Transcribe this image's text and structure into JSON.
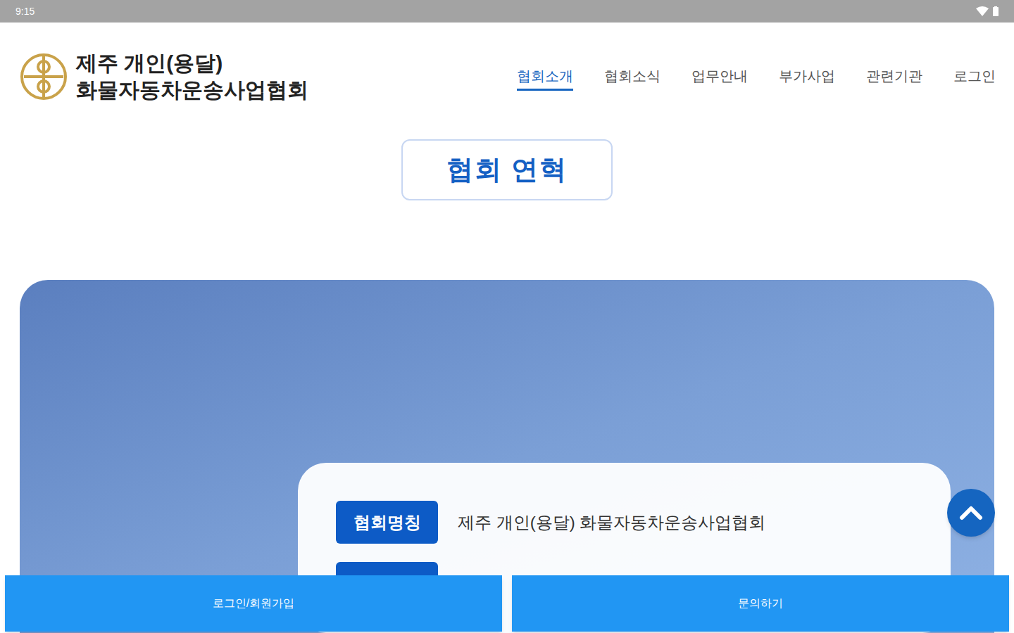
{
  "status_bar": {
    "time": "9:15"
  },
  "header": {
    "title_lines": [
      "제주 개인(용달)",
      "화물자동차운송사업협회"
    ]
  },
  "nav": [
    {
      "label": "협회소개",
      "selected": true
    },
    {
      "label": "협회소식",
      "selected": false
    },
    {
      "label": "업무안내",
      "selected": false
    },
    {
      "label": "부가사업",
      "selected": false
    },
    {
      "label": "관련기관",
      "selected": false
    },
    {
      "label": "로그인",
      "selected": false
    }
  ],
  "page_title": "협회 연혁",
  "info": [
    {
      "label": "협회명칭",
      "value": "제주 개인(용달) 화물자동차운송사업협회"
    }
  ],
  "bottom_buttons": [
    "로그인/회원가입",
    "문의하기"
  ]
}
